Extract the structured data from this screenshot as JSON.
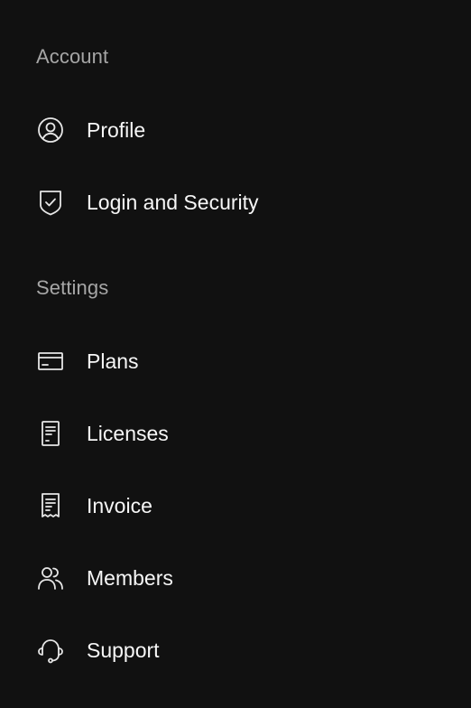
{
  "sections": {
    "account": {
      "label": "Account",
      "items": [
        {
          "label": "Profile",
          "icon": "user-circle-icon"
        },
        {
          "label": "Login and Security",
          "icon": "shield-check-icon"
        }
      ]
    },
    "settings": {
      "label": "Settings",
      "items": [
        {
          "label": "Plans",
          "icon": "credit-card-icon"
        },
        {
          "label": "Licenses",
          "icon": "document-icon"
        },
        {
          "label": "Invoice",
          "icon": "receipt-icon"
        },
        {
          "label": "Members",
          "icon": "users-icon"
        },
        {
          "label": "Support",
          "icon": "headset-icon"
        }
      ]
    }
  },
  "colors": {
    "background": "#111111",
    "section_label": "#a6a6a6",
    "item_text": "#f7f7f7",
    "icon_stroke": "#e6e6e6"
  }
}
